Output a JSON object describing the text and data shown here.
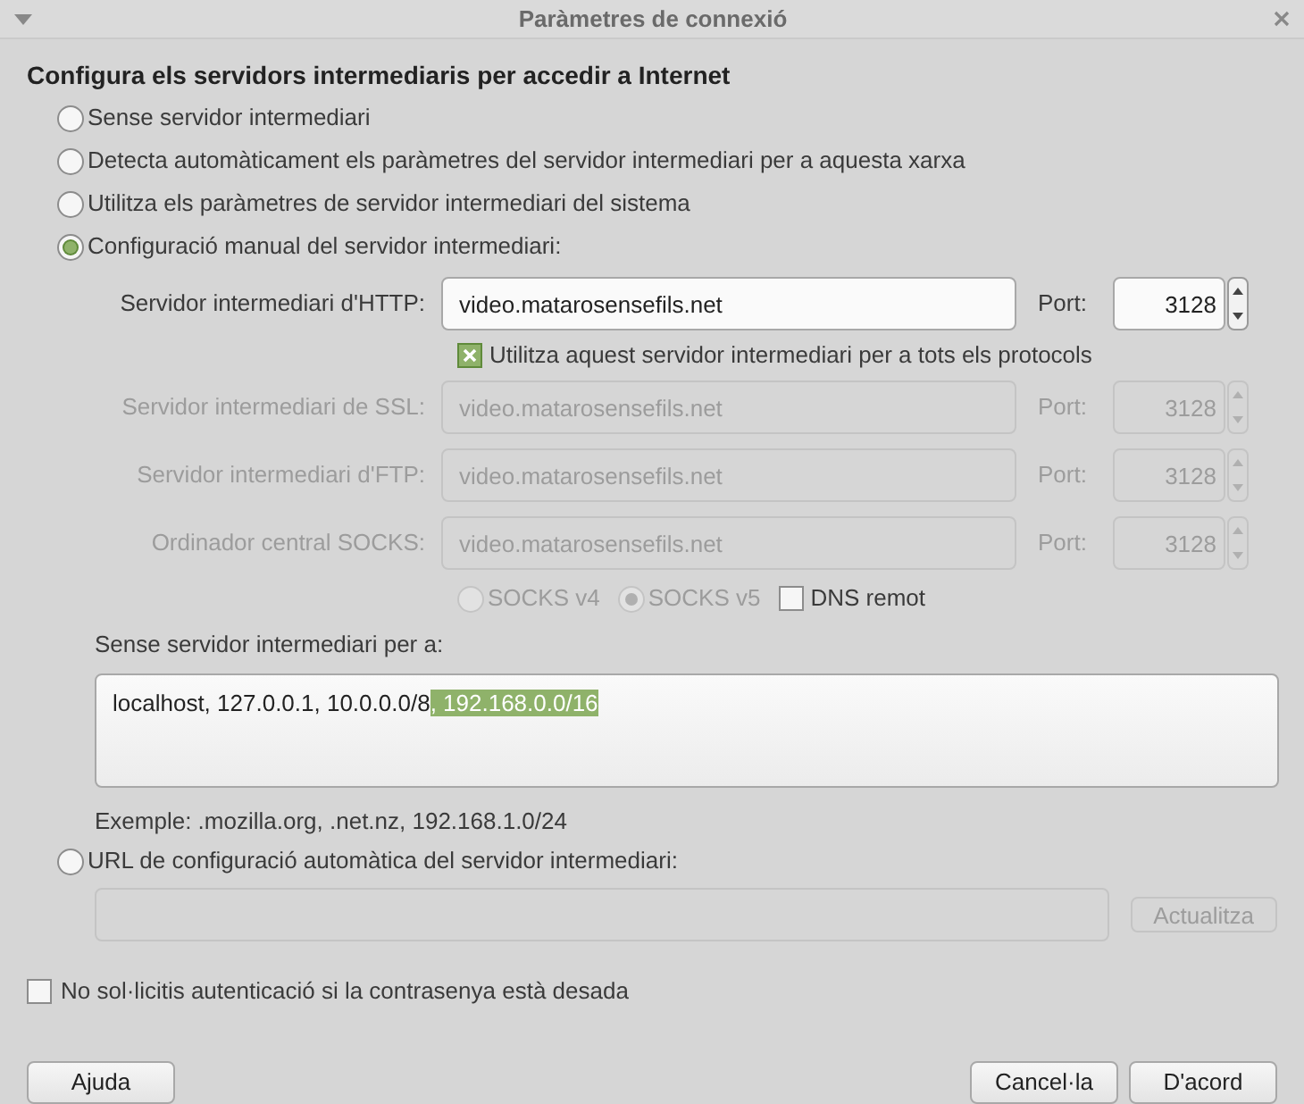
{
  "window": {
    "title": "Paràmetres de connexió"
  },
  "heading": "Configura els servidors intermediaris per accedir a Internet",
  "modes": [
    {
      "label": "Sense servidor intermediari",
      "selected": false
    },
    {
      "label": "Detecta automàticament els paràmetres del servidor intermediari per a aquesta xarxa",
      "selected": false
    },
    {
      "label": "Utilitza els paràmetres de servidor intermediari del sistema",
      "selected": false
    },
    {
      "label": "Configuració manual del servidor intermediari:",
      "selected": true
    }
  ],
  "proxies": [
    {
      "label": "Servidor intermediari d'HTTP:",
      "value": "video.matarosensefils.net",
      "port_label": "Port:",
      "port": "3128",
      "disabled": false
    },
    {
      "label": "Servidor intermediari de SSL:",
      "value": "video.matarosensefils.net",
      "port_label": "Port:",
      "port": "3128",
      "disabled": true
    },
    {
      "label": "Servidor intermediari d'FTP:",
      "value": "video.matarosensefils.net",
      "port_label": "Port:",
      "port": "3128",
      "disabled": true
    },
    {
      "label": "Ordinador central SOCKS:",
      "value": "video.matarosensefils.net",
      "port_label": "Port:",
      "port": "3128",
      "disabled": true
    }
  ],
  "share_all": {
    "label": "Utilitza aquest servidor intermediari per a tots els protocols",
    "checked": true
  },
  "socks_versions": [
    {
      "label": "SOCKS v4",
      "selected": false,
      "disabled": true
    },
    {
      "label": "SOCKS v5",
      "selected": true,
      "disabled": true
    }
  ],
  "remote_dns": {
    "label": "DNS remot",
    "checked": false
  },
  "no_proxy": {
    "label": "Sense servidor intermediari per a:",
    "value": "localhost, 127.0.0.1, 10.0.0.0/8",
    "selected_text": ", 192.168.0.0/16",
    "example": "Exemple: .mozilla.org, .net.nz, 192.168.1.0/24"
  },
  "auto_url": {
    "label": "URL de configuració automàtica del servidor intermediari:",
    "selected": false,
    "reload_button": "Actualitza",
    "disabled": true
  },
  "no_auth_prompt": {
    "label": "No sol·licitis autenticació si la contrasenya està desada",
    "checked": false
  },
  "buttons": {
    "help": "Ajuda",
    "cancel": "Cancel·la",
    "ok": "D'acord"
  }
}
